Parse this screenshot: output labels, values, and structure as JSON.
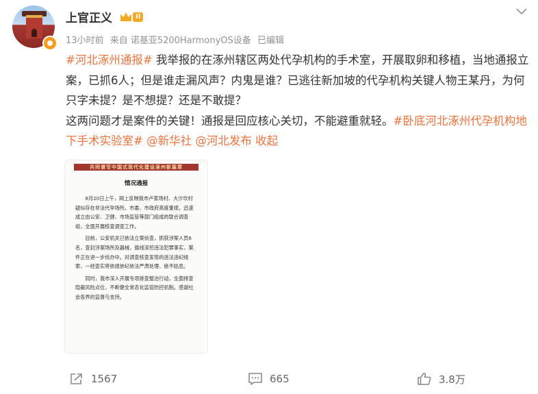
{
  "user": {
    "name": "上官正义",
    "level": "II"
  },
  "meta": {
    "time": "13小时前",
    "source": "来自 诺基亚5200HarmonyOS设备",
    "edited": "已编辑"
  },
  "post": {
    "tag1": "#河北涿州通报#",
    "text1": " 我举报的在涿州辖区两处代孕机构的手术室，开展取卵和移植，当地通报立案，已抓6人；但是谁走漏风声？内鬼是谁？已逃往新加坡的代孕机构关键人物王某丹，为何只字未提？是不想提？还是不敢提？",
    "text2": "这两问题才是案件的关键！通报是回应核心关切，不能避重就轻。",
    "tag2": "#卧底河北涿州代孕机构地下手术实验室#",
    "mention1": "@新华社",
    "mention2": "@河北发布",
    "fold": "收起"
  },
  "document": {
    "banner": "共同谱写中国式现代化建设涿州新篇章",
    "title": "情况通报",
    "paragraphs": [
      "8月20日上午，网上反映我市卢家场村、大沙坎村疑似存在非法代孕场所。市委、市政府高度重视，迅速成立由公安、卫健、市场监管等部门组成的联合调查组，全面开展核查调查工作。",
      "目前，公安机关已依法立案侦查，抓获涉案人员6名，查封涉案场所及器械，循线深挖违法犯罪事实，案件正在进一步侦办中。对调查核查发现的违法违纪线索，一经查实将依规依纪依法严肃处理、绝不姑息。",
      "同时，我市深入开展专项排查整治行动，全面排查隐蔽风险点位，不断健全常态化监管防控机制。感谢社会各界的监督与支持。"
    ]
  },
  "actions": {
    "repost": "1567",
    "comment": "665",
    "like": "3.8万"
  },
  "colors": {
    "accent": "#eb7340",
    "text": "#333333",
    "meta": "#939393",
    "vip_badge": "#f59c1a"
  },
  "icons": {
    "more": "chevron-down-icon",
    "repost": "repost-icon",
    "comment": "comment-icon",
    "like": "thumbs-up-icon"
  }
}
